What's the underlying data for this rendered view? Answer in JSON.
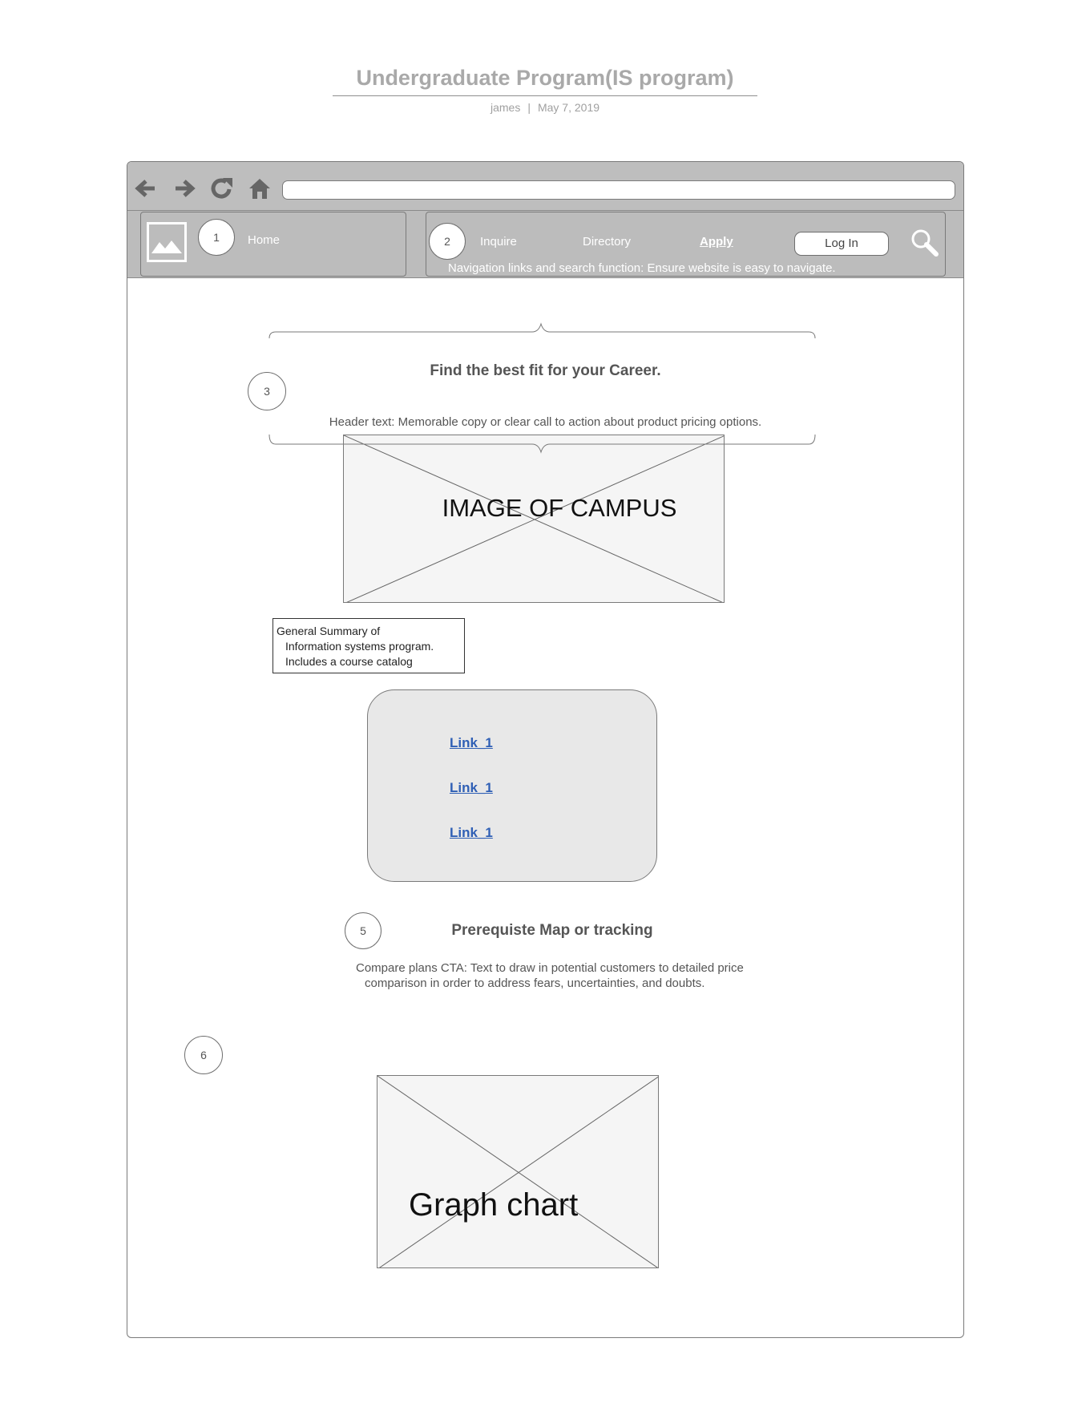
{
  "document": {
    "title": "Undergraduate Program(IS program)",
    "author": "james",
    "separator": "|",
    "date": "May 7, 2019"
  },
  "browser": {
    "toolbar_icons": [
      "back-arrow-icon",
      "forward-arrow-icon",
      "reload-icon",
      "home-icon"
    ],
    "address_value": ""
  },
  "header": {
    "marker_logo": "1",
    "home_label": "Home",
    "marker_nav": "2",
    "nav_items": [
      "Inquire",
      "Directory",
      "Apply"
    ],
    "login_label": "Log In",
    "search_icon": "search-icon",
    "nav_note": "Navigation links and search function: Ensure website is easy to navigate."
  },
  "hero": {
    "marker": "3",
    "heading": "Find the best fit for your Career.",
    "subtext": "Header text: Memorable copy or clear call to action about product pricing options.",
    "image_label": "IMAGE OF CAMPUS"
  },
  "summary": {
    "lines": [
      "General Summary of",
      "Information systems program.",
      "Includes a course catalog"
    ]
  },
  "links_panel": {
    "links": [
      "Link_1",
      "Link_1",
      "Link_1"
    ]
  },
  "prereq": {
    "marker": "5",
    "heading": "Prerequiste Map or tracking",
    "line1": "Compare plans CTA: Text to draw in potential customers to detailed price",
    "line2": "comparison in order to address fears, uncertainties, and doubts."
  },
  "graph": {
    "marker": "6",
    "label": "Graph chart"
  },
  "colors": {
    "toolbar": "#bebebe",
    "link": "#2f5fb5",
    "panel": "#e8e8e8",
    "placeholder": "#f5f5f5"
  }
}
